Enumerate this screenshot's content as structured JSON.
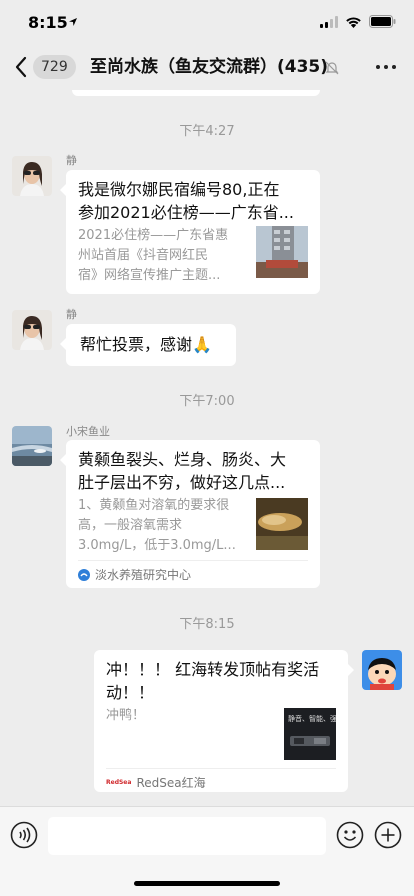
{
  "status_bar": {
    "time": "8:15",
    "location_icon": "location-arrow-icon",
    "signal_icon": "cellular-signal-icon",
    "wifi_icon": "wifi-icon",
    "battery_icon": "battery-icon"
  },
  "nav": {
    "back_icon": "chevron-left-icon",
    "unread_count": "729",
    "title": "至尚水族（鱼友交流群）(435)",
    "mute_icon": "mute-bell-icon",
    "more_icon": "more-dots-icon"
  },
  "messages": {
    "ts1": "下午4:27",
    "msg1": {
      "sender": "静",
      "title_line1": "我是微尔娜民宿编号80,正在",
      "title_line2": "参加2021必住榜——广东省...",
      "desc_line1": "2021必住榜——广东省惠",
      "desc_line2": "州站首届《抖音网红民",
      "desc_line3": "宿》网络宣传推广主题..."
    },
    "msg2": {
      "sender": "静",
      "text": "帮忙投票，感谢🙏"
    },
    "ts2": "下午7:00",
    "msg3": {
      "sender": "小宋鱼业",
      "title_line1": "黄颡鱼裂头、烂身、肠炎、大",
      "title_line2": "肚子层出不穷，做好这几点...",
      "desc_line1": "1、黄颡鱼对溶氧的要求很",
      "desc_line2": "高，一般溶氧需求",
      "desc_line3": "3.0mg/L，低于3.0mg/L...",
      "source": "淡水养殖研究中心"
    },
    "ts3": "下午8:15",
    "msg4": {
      "title_line1": "冲！！！ 红海转发顶帖有奖活",
      "title_line2": "动！！",
      "desc": "冲鸭！",
      "thumb_text1": "静音、智能、强劲",
      "source_logo": "RedSea",
      "source": "RedSea红海"
    }
  },
  "input_bar": {
    "voice_icon": "voice-icon",
    "emoji_icon": "emoji-icon",
    "plus_icon": "plus-icon"
  },
  "colors": {
    "background": "#ededed",
    "bubble": "#ffffff",
    "timestamp": "#999999",
    "source_logo_red": "#d0282c"
  }
}
